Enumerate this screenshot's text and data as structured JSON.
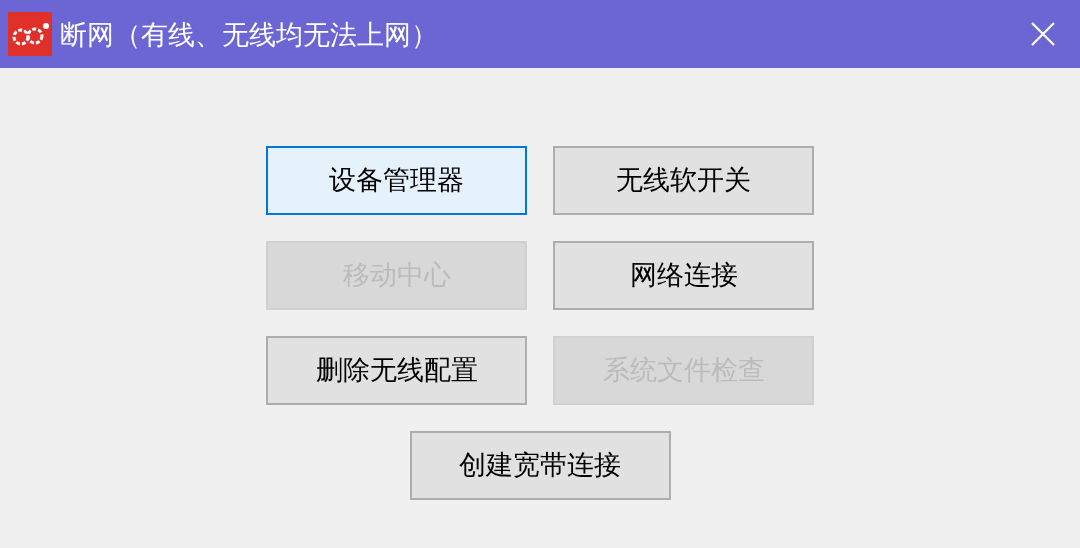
{
  "window": {
    "title": "断网（有线、无线均无法上网）"
  },
  "button_rows": [
    {
      "buttons": [
        {
          "label": "设备管理器",
          "disabled": false,
          "focused": true
        },
        {
          "label": "无线软开关",
          "disabled": false,
          "focused": false
        }
      ]
    },
    {
      "buttons": [
        {
          "label": "移动中心",
          "disabled": true,
          "focused": false
        },
        {
          "label": "网络连接",
          "disabled": false,
          "focused": false
        }
      ]
    },
    {
      "buttons": [
        {
          "label": "删除无线配置",
          "disabled": false,
          "focused": false
        },
        {
          "label": "系统文件检查",
          "disabled": true,
          "focused": false
        }
      ]
    },
    {
      "buttons": [
        {
          "label": "创建宽带连接",
          "disabled": false,
          "focused": false
        }
      ]
    }
  ]
}
